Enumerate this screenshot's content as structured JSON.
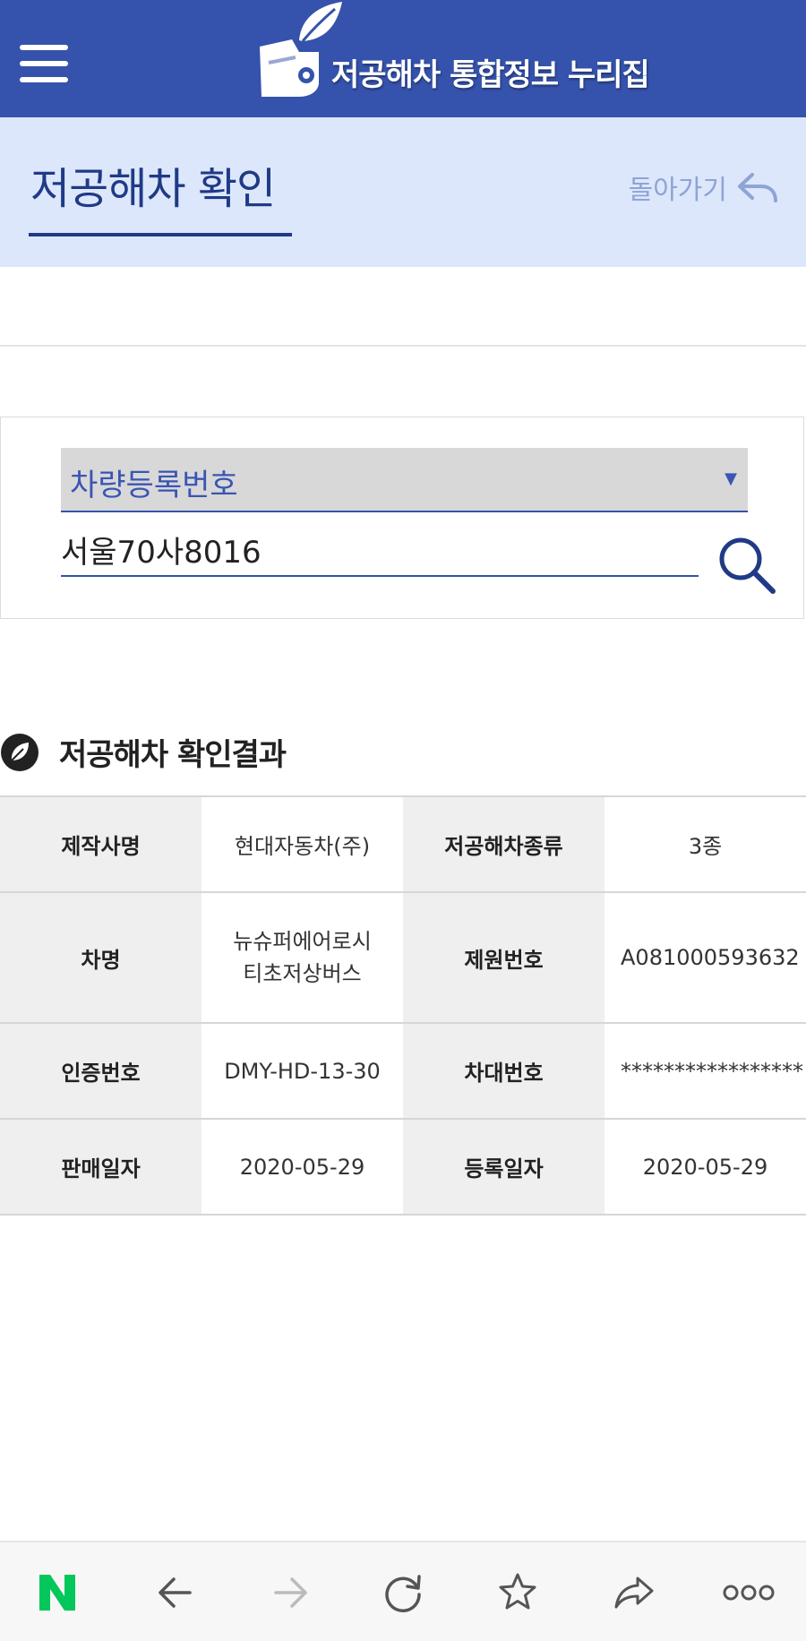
{
  "header": {
    "site_title": "저공해차 통합정보 누리집"
  },
  "subheader": {
    "page_title": "저공해차 확인",
    "back_label": "돌아가기"
  },
  "search": {
    "select_value": "차량등록번호",
    "input_value": "서울70사8016"
  },
  "result": {
    "title": "저공해차 확인결과",
    "rows": [
      [
        "제작사명",
        "현대자동차(주)",
        "저공해차종류",
        "3종"
      ],
      [
        "차명",
        "뉴슈퍼에어로시티초저상버스",
        "제원번호",
        "A081000593632"
      ],
      [
        "인증번호",
        "DMY-HD-13-30",
        "차대번호",
        "*****************"
      ],
      [
        "판매일자",
        "2020-05-29",
        "등록일자",
        "2020-05-29"
      ]
    ]
  },
  "colors": {
    "header_bg": "#3552ac",
    "subheader_bg": "#dde7fb",
    "accent": "#1f3a86",
    "naver_green": "#03c75a"
  },
  "browser_bar": {
    "icons": [
      "naver-icon",
      "back-arrow-icon",
      "forward-arrow-icon",
      "reload-icon",
      "star-icon",
      "share-icon",
      "more-icon"
    ]
  }
}
